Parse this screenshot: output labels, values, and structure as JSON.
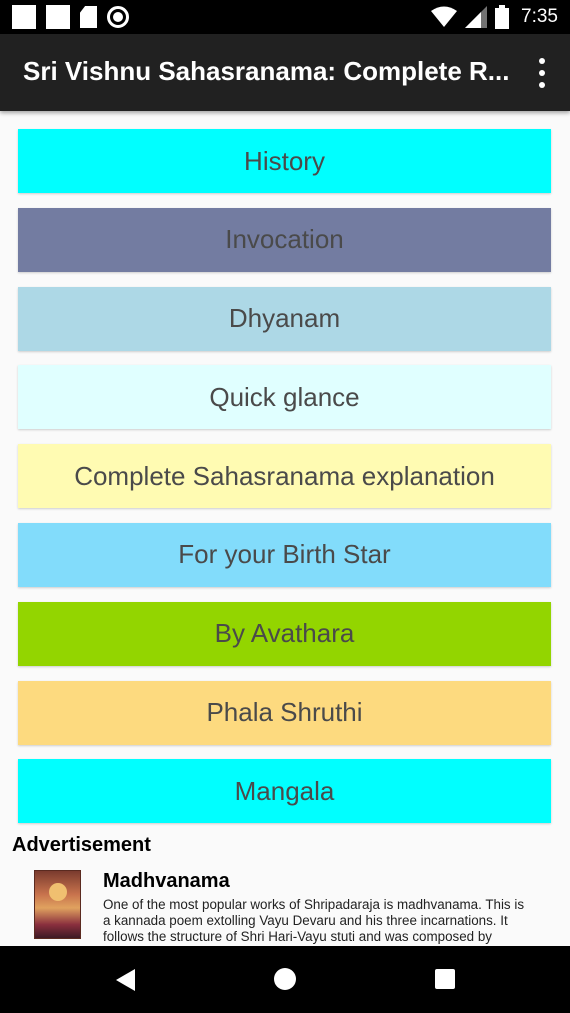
{
  "status_bar": {
    "time": "7:35",
    "icons": [
      "notification-square-icon",
      "notification-square-icon",
      "sd-card-icon",
      "circle-sync-icon",
      "wifi-icon",
      "signal-icon",
      "battery-icon"
    ]
  },
  "app_bar": {
    "title": "Sri Vishnu Sahasranama: Complete R...",
    "menu_icon": "more-vert-icon"
  },
  "menu": [
    {
      "id": "history",
      "label": "History",
      "color": "#00ffff"
    },
    {
      "id": "invocation",
      "label": "Invocation",
      "color": "#737ca1"
    },
    {
      "id": "dhyanam",
      "label": "Dhyanam",
      "color": "#add8e6"
    },
    {
      "id": "quick-glance",
      "label": "Quick glance",
      "color": "#e0ffff"
    },
    {
      "id": "complete-explanation",
      "label": "Complete Sahasranama explanation",
      "color": "#fffbb2"
    },
    {
      "id": "birth-star",
      "label": "For your Birth Star",
      "color": "#82dcfb"
    },
    {
      "id": "by-avathara",
      "label": "By Avathara",
      "color": "#93d500"
    },
    {
      "id": "phala-shruthi",
      "label": "Phala Shruthi",
      "color": "#fdda7f"
    },
    {
      "id": "mangala",
      "label": "Mangala",
      "color": "#00ffff"
    }
  ],
  "advertisement": {
    "heading": "Advertisement",
    "title": "Madhvanama",
    "description": "One of the most popular works of Shripadaraja is madhvanama. This is a kannada poem extolling Vayu Devaru and his three incarnations. It follows the structure of Shri Hari-Vayu stuti and was composed by"
  },
  "nav_bar": {
    "icons": [
      "back-icon",
      "home-icon",
      "recents-icon"
    ]
  }
}
